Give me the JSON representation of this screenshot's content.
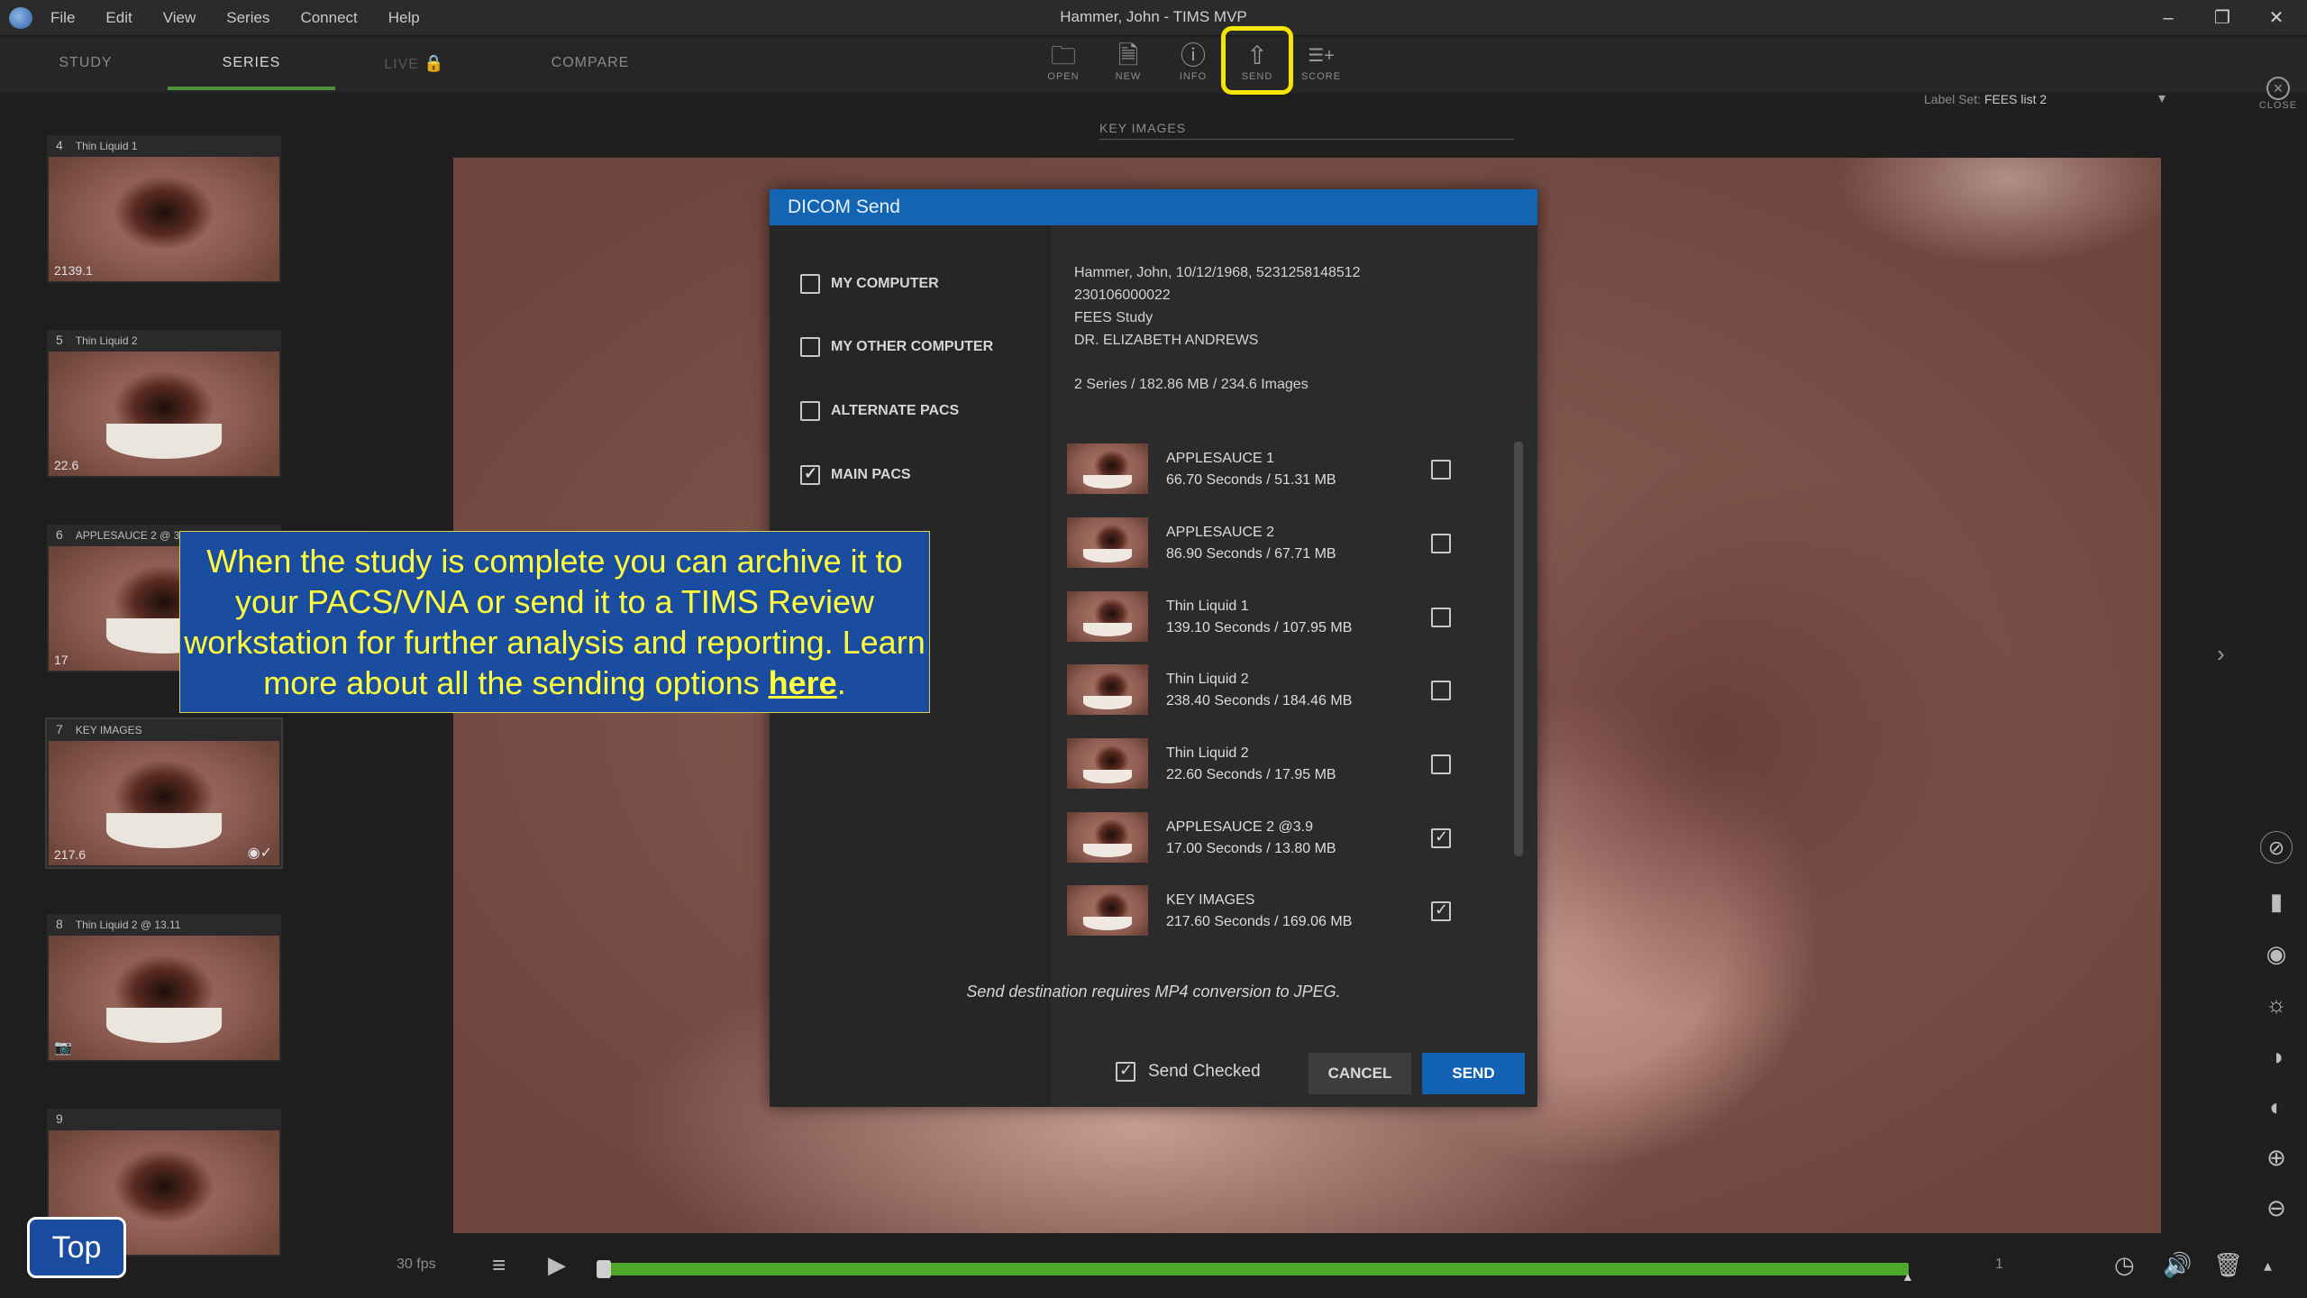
{
  "window": {
    "title": "Hammer, John - TIMS MVP",
    "menu": [
      "File",
      "Edit",
      "View",
      "Series",
      "Connect",
      "Help"
    ],
    "controls": [
      "–",
      "❐",
      "✕"
    ]
  },
  "tabs": {
    "study": "STUDY",
    "series": "SERIES",
    "live": "LIVE",
    "compare": "COMPARE"
  },
  "tools": {
    "open": "OPEN",
    "new": "NEW",
    "info": "INFO",
    "send": "SEND",
    "score": "SCORE",
    "close": "CLOSE"
  },
  "label_set": {
    "prefix": "Label Set:",
    "value": "FEES list 2"
  },
  "thumbnails": [
    {
      "num": "4",
      "title": "Thin Liquid 1",
      "duration": "2139.1",
      "icon": ""
    },
    {
      "num": "5",
      "title": "Thin Liquid 2",
      "duration": "22.6",
      "icon": ""
    },
    {
      "num": "6",
      "title": "APPLESAUCE 2 @ 3.9",
      "duration": "17",
      "icon": ""
    },
    {
      "num": "7",
      "title": "KEY IMAGES",
      "duration": "217.6",
      "icon": "◉✓"
    },
    {
      "num": "8",
      "title": "Thin Liquid 2 @ 13.11",
      "duration": "",
      "icon": ""
    },
    {
      "num": "9",
      "title": "",
      "duration": "",
      "icon": ""
    }
  ],
  "viewer": {
    "title": "KEY IMAGES"
  },
  "playback": {
    "fps": "30 fps",
    "frame": "1",
    "progress": 0.0
  },
  "dialog": {
    "title": "DICOM Send",
    "destinations": [
      {
        "label": "MY COMPUTER",
        "checked": false
      },
      {
        "label": "MY OTHER COMPUTER",
        "checked": false
      },
      {
        "label": "ALTERNATE PACS",
        "checked": false
      },
      {
        "label": "MAIN PACS",
        "checked": true
      }
    ],
    "patient": {
      "line1": "Hammer, John, 10/12/1968, 5231258148512",
      "line2": "230106000022",
      "line3": "FEES Study",
      "line4": "DR. ELIZABETH ANDREWS"
    },
    "summary": "2 Series / 182.86 MB / 234.6 Images",
    "series": [
      {
        "name": "APPLESAUCE 1",
        "meta": "66.70 Seconds / 51.31 MB",
        "checked": false
      },
      {
        "name": "APPLESAUCE 2",
        "meta": "86.90 Seconds / 67.71 MB",
        "checked": false
      },
      {
        "name": "Thin Liquid 1",
        "meta": "139.10 Seconds / 107.95 MB",
        "checked": false
      },
      {
        "name": "Thin Liquid 2",
        "meta": "238.40 Seconds / 184.46 MB",
        "checked": false
      },
      {
        "name": "Thin Liquid 2",
        "meta": "22.60 Seconds / 17.95 MB",
        "checked": false
      },
      {
        "name": "APPLESAUCE 2 @3.9",
        "meta": "17.00 Seconds / 13.80 MB",
        "checked": true
      },
      {
        "name": "KEY IMAGES",
        "meta": "217.60 Seconds / 169.06 MB",
        "checked": true
      }
    ],
    "note": "Send destination requires MP4 conversion to JPEG.",
    "send_checked_label": "Send Checked",
    "cancel_label": "CANCEL",
    "send_label": "SEND"
  },
  "callout": {
    "text_before": "When the study is complete you can archive it to your PACS/VNA or send it to a TIMS Review workstation for further analysis and reporting. Learn more about all the sending options ",
    "link": "here",
    "text_after": "."
  },
  "top_button": "Top",
  "colors": {
    "accent_blue": "#1464b4",
    "highlight_yellow": "#f4e600",
    "progress_green": "#4ea82c",
    "callout_bg": "#1a4da0",
    "callout_text": "#ffff3a"
  }
}
